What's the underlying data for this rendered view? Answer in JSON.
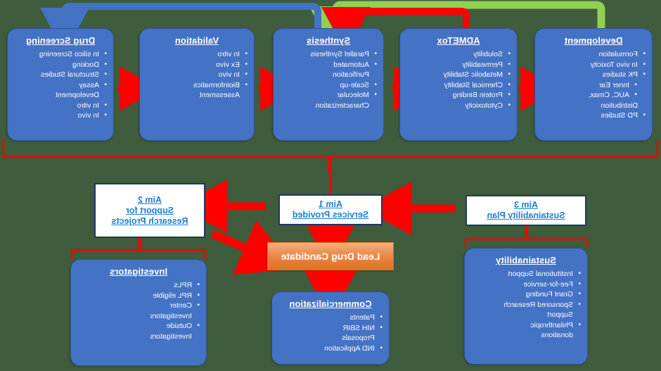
{
  "diagram": {
    "title": "Drug Discovery Pipeline and Aims",
    "colors": {
      "card_blue": "#4472c4",
      "accent_red": "#ff0000",
      "accent_green": "#92d050",
      "accent_blue": "#4472c4",
      "lead_orange": "#e4792f",
      "aim_border": "#1f3864",
      "aim_text": "#1f7fd0",
      "background": "#3f5c3c"
    }
  },
  "pipeline": [
    {
      "id": "development",
      "title": "Development",
      "items": [
        {
          "text": "Formulation",
          "bullet": true,
          "sub": false
        },
        {
          "text": "In vivo Toxicity",
          "bullet": true,
          "sub": false
        },
        {
          "text": "PK studies",
          "bullet": true,
          "sub": false
        },
        {
          "text": "Inner Ear",
          "bullet": true,
          "sub": true
        },
        {
          "text": "AUC, Cmax,",
          "bullet": true,
          "sub": true
        },
        {
          "text": "Distribution",
          "bullet": false,
          "sub": false
        },
        {
          "text": "PD Studies",
          "bullet": true,
          "sub": false
        }
      ]
    },
    {
      "id": "admetox",
      "title": "ADMETox",
      "items": [
        {
          "text": "Solubility",
          "bullet": true,
          "sub": false
        },
        {
          "text": "Permeability",
          "bullet": true,
          "sub": false
        },
        {
          "text": "Metabolic Stability",
          "bullet": true,
          "sub": false
        },
        {
          "text": "Chemical Stability",
          "bullet": true,
          "sub": false
        },
        {
          "text": "Protein Binding",
          "bullet": true,
          "sub": false
        },
        {
          "text": "Cytotoxicity",
          "bullet": true,
          "sub": false
        }
      ]
    },
    {
      "id": "synthesis",
      "title": "Synthesis",
      "items": [
        {
          "text": "Parallel Synthesis",
          "bullet": true,
          "sub": false
        },
        {
          "text": "Automated",
          "bullet": true,
          "sub": false
        },
        {
          "text": "Purification",
          "bullet": false,
          "sub": false
        },
        {
          "text": "Scale-up",
          "bullet": true,
          "sub": false
        },
        {
          "text": "Molecular",
          "bullet": true,
          "sub": false
        },
        {
          "text": "Characterization",
          "bullet": false,
          "sub": false
        }
      ]
    },
    {
      "id": "validation",
      "title": "Validation",
      "items": [
        {
          "text": "In vitro",
          "bullet": true,
          "sub": false
        },
        {
          "text": "Ex vivo",
          "bullet": true,
          "sub": false
        },
        {
          "text": "In vivo",
          "bullet": true,
          "sub": false
        },
        {
          "text": "Bioinformatics",
          "bullet": true,
          "sub": false
        },
        {
          "text": "Assessment",
          "bullet": false,
          "sub": false
        }
      ]
    },
    {
      "id": "drug-screening",
      "title": "Drug Screening",
      "items": [
        {
          "text": "In silico Screening",
          "bullet": true,
          "sub": false
        },
        {
          "text": "Docking",
          "bullet": true,
          "sub": false
        },
        {
          "text": "Structural Studies",
          "bullet": true,
          "sub": false
        },
        {
          "text": "Assay",
          "bullet": true,
          "sub": false
        },
        {
          "text": "Development",
          "bullet": false,
          "sub": false
        },
        {
          "text": "In vitro",
          "bullet": true,
          "sub": false
        },
        {
          "text": "In vivo",
          "bullet": true,
          "sub": false
        }
      ]
    }
  ],
  "aims": {
    "aim3": {
      "line1": "Aim 3",
      "line2": "Sustainability Plan"
    },
    "aim1": {
      "line1": "Aim 1",
      "line2": "Services Provided"
    },
    "aim2": {
      "line1": "Aim 2",
      "line2": "Support for",
      "line3": "Research Projects"
    }
  },
  "lead_candidate": {
    "label": "Lead Drug Candidate"
  },
  "lower_cards": [
    {
      "id": "sustainability",
      "title": "Sustainability",
      "items": [
        {
          "text": "Institutional Support",
          "bullet": true,
          "sub": false
        },
        {
          "text": "Fee-for-service",
          "bullet": true,
          "sub": false
        },
        {
          "text": "Grant Funding",
          "bullet": true,
          "sub": false
        },
        {
          "text": "Sponsored Research",
          "bullet": true,
          "sub": false
        },
        {
          "text": "Support",
          "bullet": false,
          "sub": false
        },
        {
          "text": "Philanthropic",
          "bullet": true,
          "sub": false
        },
        {
          "text": "donations",
          "bullet": false,
          "sub": false
        }
      ]
    },
    {
      "id": "commercialization",
      "title": "Commercialization",
      "items": [
        {
          "text": "Patents",
          "bullet": true,
          "sub": false
        },
        {
          "text": "NIH SBIR",
          "bullet": true,
          "sub": false
        },
        {
          "text": "Proposals",
          "bullet": false,
          "sub": false
        },
        {
          "text": "IND Application",
          "bullet": true,
          "sub": false
        }
      ]
    },
    {
      "id": "investigators",
      "title": "Investigators",
      "items": [
        {
          "text": "RPLs",
          "bullet": true,
          "sub": false
        },
        {
          "text": "RPL eligible",
          "bullet": true,
          "sub": false
        },
        {
          "text": "Center",
          "bullet": true,
          "sub": false
        },
        {
          "text": "Investigators",
          "bullet": false,
          "sub": false
        },
        {
          "text": "Outside",
          "bullet": true,
          "sub": false
        },
        {
          "text": "Investigators",
          "bullet": false,
          "sub": false
        }
      ]
    }
  ]
}
